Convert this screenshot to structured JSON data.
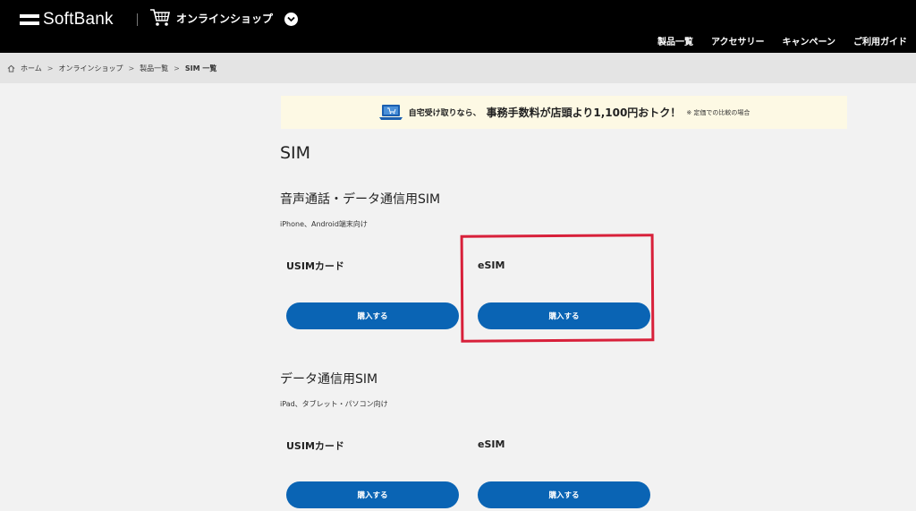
{
  "header": {
    "logo_text": "SoftBank",
    "shop_label": "オンラインショップ",
    "nav": [
      "製品一覧",
      "アクセサリー",
      "キャンペーン",
      "ご利用ガイド"
    ]
  },
  "breadcrumb": {
    "items": [
      "ホーム",
      "オンラインショップ",
      "製品一覧",
      "SIM 一覧"
    ],
    "separator": ">"
  },
  "banner": {
    "pre_text": "自宅受け取りなら、",
    "main_text": "事務手数料が店頭より1,100円おトク！",
    "note": "※ 定価での比較の場合"
  },
  "page_title": "SIM",
  "sections": [
    {
      "title": "音声通話・データ通信用SIM",
      "subtitle": "iPhone、Android端末向け",
      "products": [
        {
          "name": "USIMカード",
          "button": "購入する"
        },
        {
          "name": "eSIM",
          "button": "購入する"
        }
      ]
    },
    {
      "title": "データ通信用SIM",
      "subtitle": "iPad、タブレット・パソコン向け",
      "products": [
        {
          "name": "USIMカード",
          "button": "購入する"
        },
        {
          "name": "eSIM",
          "button": "購入する"
        }
      ]
    }
  ],
  "colors": {
    "header_bg": "#000000",
    "button_bg": "#0a64b4",
    "banner_bg": "#fdf9e4",
    "highlight": "#d8203a"
  }
}
